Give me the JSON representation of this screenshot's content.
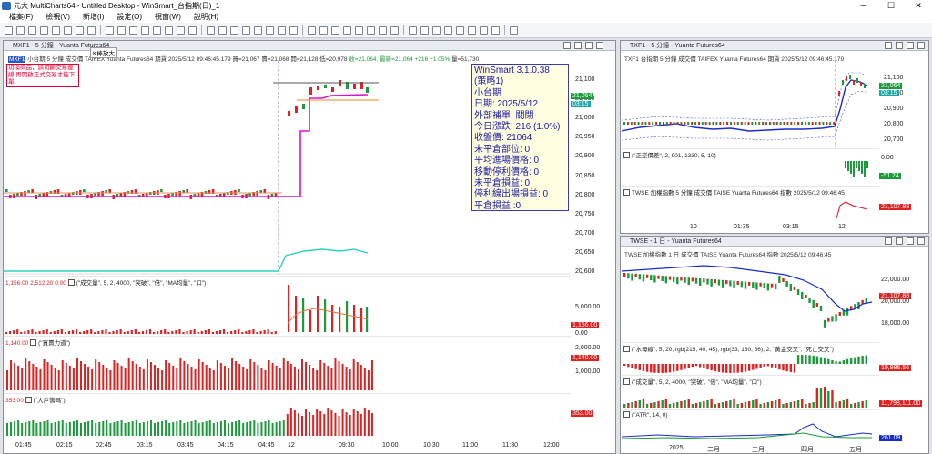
{
  "app": {
    "title": "元大 MultiCharts64 - Untitled Desktop - WinSmart_台指期(日)_1"
  },
  "menu": [
    "檔案(F)",
    "檢視(V)",
    "新增(I)",
    "設定(O)",
    "視窗(W)",
    "說明(H)"
  ],
  "main": {
    "title": "MXF1 - 5 分鐘 - Yuanta Futures64",
    "symbol": "MXF1",
    "info": "小台期  5 分鐘  成交價  TAIFEX  Yuanta Futures64  期貨  2025/5/12  09:46:45.179  買=21,067  賣=21,068  開=21,128  低=20,978",
    "change": "收=21,064, 最新=21,064  +216  +1.05%",
    "volume": "量=51,730",
    "tooltip": "K棒放大",
    "notice": "切換商品，請切斷交易連線 再開啟正式交易才能下單!",
    "price_ticks": [
      "21,100",
      "21,050",
      "21,000",
      "20,950",
      "20,900",
      "20,850",
      "20,800",
      "20,750",
      "20,700",
      "20,650",
      "20,600"
    ],
    "last_price": "21,064",
    "tag_small": "03:15",
    "vol_hdr": "1,156.00  2,512.20  0.00",
    "vol_label": "(\"成交量\", 5, 2, 4000, \"突破\", \"倍\", \"MA均量\", \"口\")",
    "vol_ticks": [
      "5,000.00",
      "0.00"
    ],
    "vol_tag": "1,156.00",
    "bs_hdr": "1,140.00",
    "bs_label": "(\"買賣力道\")",
    "bs_ticks": [
      "2,000.00",
      "1,000.00"
    ],
    "bs_tag": "1,140.00",
    "lg_hdr": "353.00",
    "lg_label": "(\"大戶籌碼\")",
    "lg_tag": "353.00",
    "time_ticks": [
      "01:45",
      "02:15",
      "02:45",
      "03:15",
      "03:45",
      "04:15",
      "04:45",
      "12",
      "09:30",
      "10:00",
      "10:30",
      "11:00",
      "11:30",
      "12:00"
    ],
    "win": {
      "lines": [
        "WinSmart 3.1.0.38",
        "(策略1)",
        "小台期",
        "日期: 2025/5/12",
        "外部補單: 關閉",
        "今日漲跌: 216 (1.0%)",
        "收盤價: 21064",
        "未平倉部位: 0",
        "平均進場價格: 0",
        "移動停利價格: 0",
        "未平倉損益: 0",
        "停利線出場損益: 0",
        "平倉損益 :0"
      ]
    }
  },
  "tr": {
    "title": "TXF1 - 5 分鐘 - Yuanta Futures64",
    "info": "TXF1  台指期  5 分鐘  成交價  TAIFEX  Yuanta Futures64  期貨  2025/5/12  09:46:45.179",
    "ticks": [
      "21,100",
      "21,000",
      "20,900",
      "20,800",
      "20,700"
    ],
    "tag": "21,064",
    "tag2": "03:15",
    "sub1": "(\"正逆價差\", 2, 901, 1330, 5, 10)",
    "sub1_ticks": [
      "0.00",
      "-51.24"
    ],
    "sub2": "TWSE  加權指數  5 分鐘  成交價  TAISE  Yuanta Futures64  指數  2025/5/12  09:46:45",
    "sub2_tag": "21,107.88",
    "time_ticks": [
      "10",
      "01:35",
      "03:15",
      "12"
    ]
  },
  "br": {
    "title": "TWSE - 1 日 - Yuanta Futures64",
    "info": "TWSE  加權指數  1 日  成交價  TAISE  Yuanta Futures64  指數  2025/5/12  09:46:45",
    "ticks": [
      "22,000.00",
      "20,000.00",
      "18,000.00"
    ],
    "tag": "21,107.88",
    "sub1": "(\"水母線\", 5, 20, rgb(215, 40, 45), rgb(33, 180, 66), 2, \"黃金交叉\", \"死亡交叉\")",
    "sub1_tag": "19,986.56",
    "sub2": "(\"成交量\", 5, 2, 4000, \"突破\", \"倍\", \"MA均量\", \"口\")",
    "sub2_tag": "11,798,111.00",
    "sub3": "(\"ATR\", 14, 0)",
    "sub3_tag": "261.09",
    "time_ticks": [
      "2025",
      "二月",
      "三月",
      "四月",
      "五月"
    ]
  }
}
